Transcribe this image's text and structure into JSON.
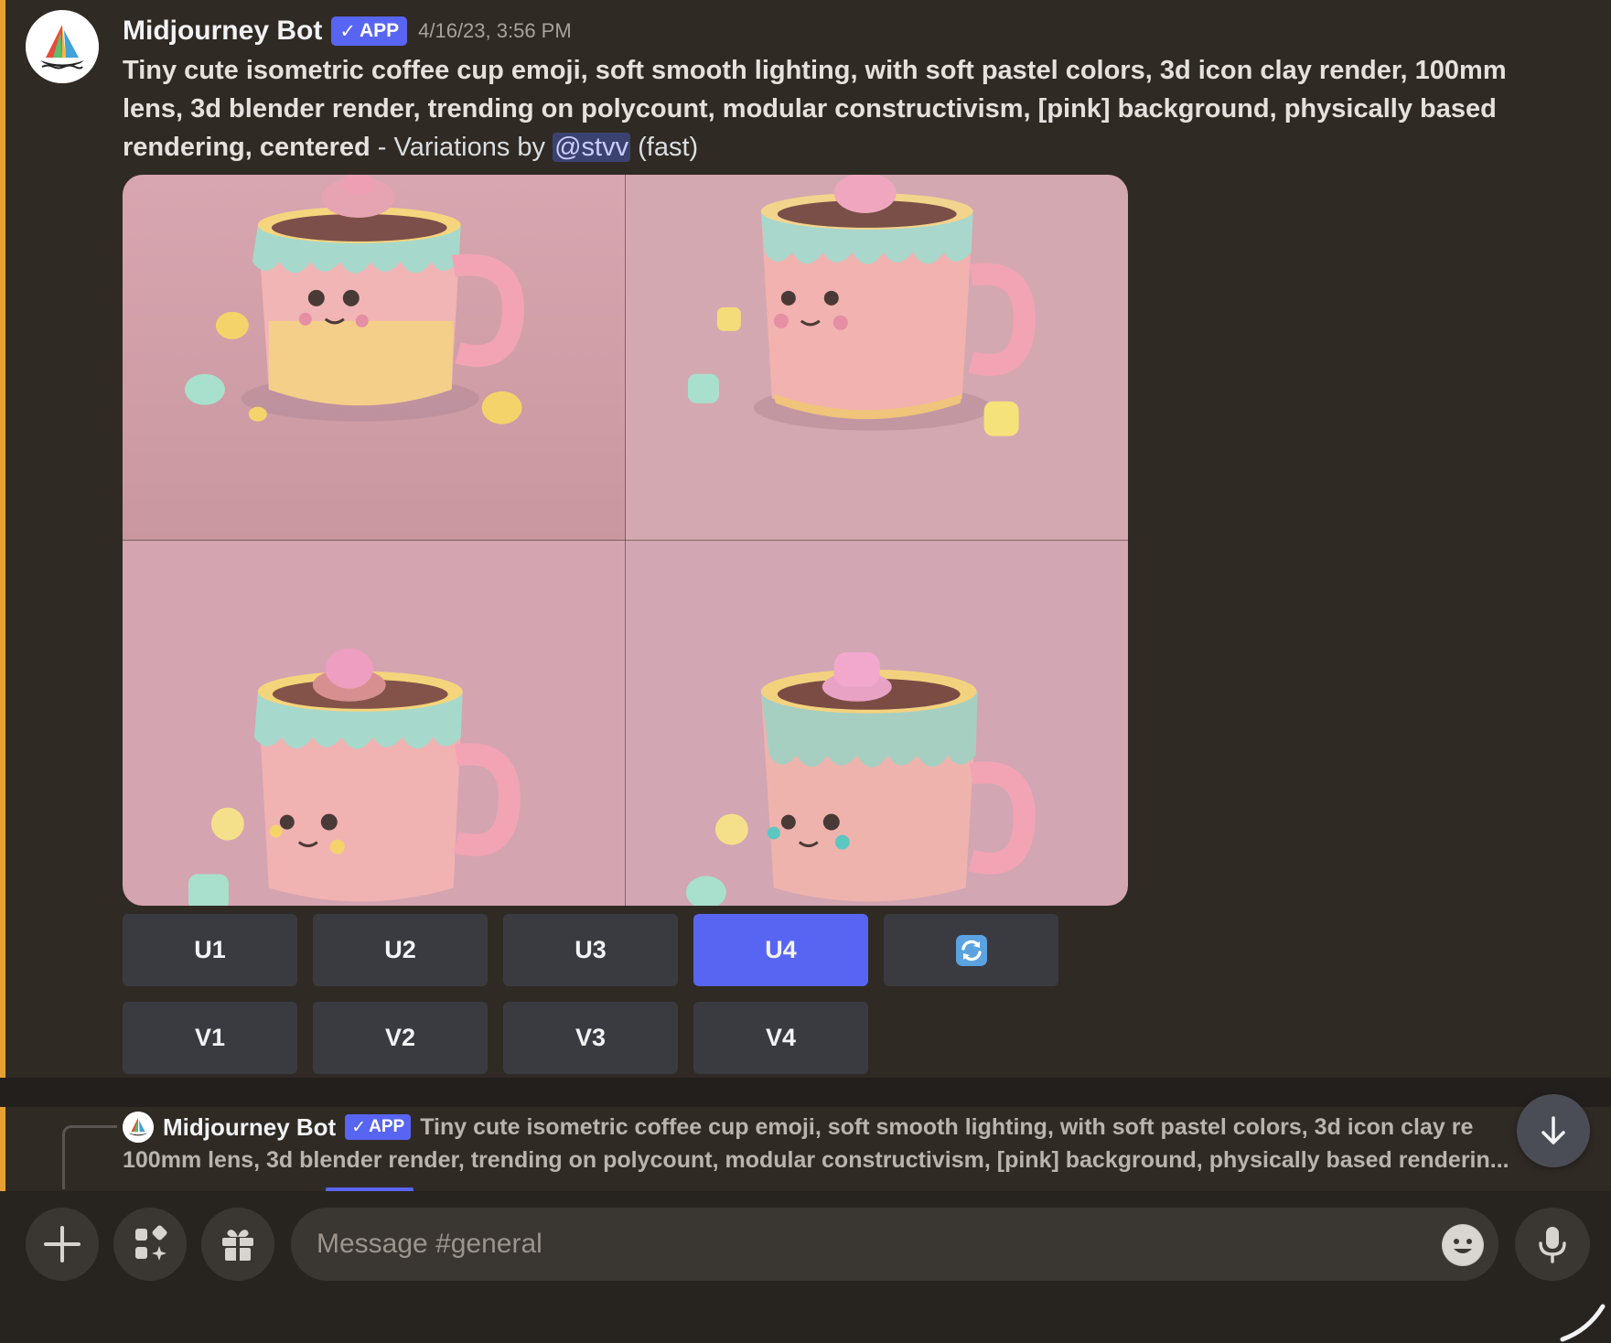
{
  "message": {
    "username": "Midjourney Bot",
    "badge": "APP",
    "timestamp": "4/16/23, 3:56 PM",
    "prompt_bold": "Tiny cute isometric coffee cup emoji, soft smooth lighting, with soft pastel colors, 3d icon clay render, 100mm lens, 3d blender render, trending on polycount, modular constructivism, [pink] background, physically based rendering, centered",
    "prompt_suffix": " - Variations by ",
    "mention": "@stvv",
    "mode": " (fast)",
    "image_alt": "four pastel coffee cup emoji variations"
  },
  "buttons": {
    "row1": [
      "U1",
      "U2",
      "U3",
      "U4"
    ],
    "row2": [
      "V1",
      "V2",
      "V3",
      "V4"
    ],
    "active": "U4",
    "reroll_icon": "refresh-icon"
  },
  "reply": {
    "username": "Midjourney Bot",
    "badge": "APP",
    "line1": "Tiny cute isometric coffee cup emoji, soft smooth lighting, with soft pastel colors, 3d icon clay re",
    "line2": "100mm lens, 3d blender render, trending on polycount, modular constructivism, [pink] background, physically based renderin..."
  },
  "composer": {
    "placeholder": "Message #general",
    "icons": [
      "plus-icon",
      "apps-icon",
      "gift-icon",
      "emoji-icon",
      "microphone-icon"
    ]
  },
  "colors": {
    "accent": "#5865f2",
    "mention_bar": "#e5a134",
    "background": "#302a25"
  }
}
